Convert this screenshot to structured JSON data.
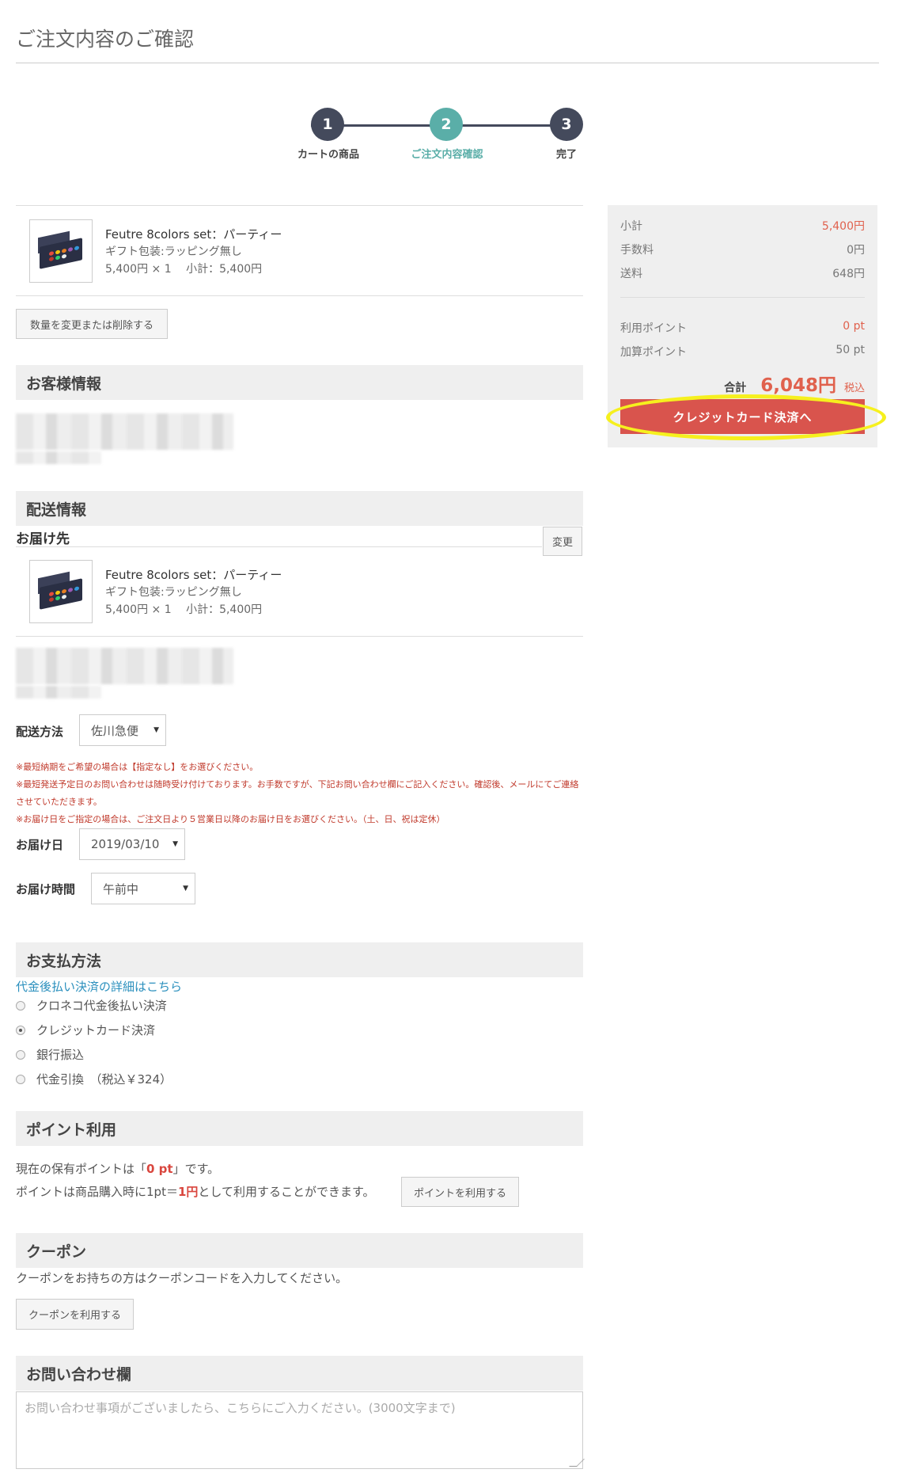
{
  "page": {
    "title": "ご注文内容のご確認"
  },
  "steps": [
    {
      "number": "1",
      "label": "カートの商品"
    },
    {
      "number": "2",
      "label": "ご注文内容確認"
    },
    {
      "number": "3",
      "label": "完了"
    }
  ],
  "cart_item": {
    "name": "Feutre 8colors set：パーティー",
    "gift": "ギフト包装:ラッピング無し",
    "price": "5,400円 × 1　 小計：5,400円",
    "change_button": "数量を変更または削除する"
  },
  "customer": {
    "header": "お客様情報"
  },
  "shipping": {
    "header": "配送情報",
    "destination_label": "お届け先",
    "change_button": "変更",
    "item_name": "Feutre 8colors set：パーティー",
    "item_gift": "ギフト包装:ラッピング無し",
    "item_price": "5,400円 × 1　 小計：5,400円",
    "method_label": "配送方法",
    "method_value": "佐川急便",
    "notes": [
      "※最短納期をご希望の場合は【指定なし】をお選びください。",
      "※最短発送予定日のお問い合わせは随時受け付けております。お手数ですが、下記お問い合わせ欄にご記入ください。確認後、メールにてご連絡させていただきます。",
      "※お届け日をご指定の場合は、ご注文日より５営業日以降のお届け日をお選びください。（土、日、祝は定休）"
    ],
    "date_label": "お届け日",
    "date_value": "2019/03/10",
    "time_label": "お届け時間",
    "time_value": "午前中"
  },
  "payment": {
    "header": "お支払方法",
    "link": "代金後払い決済の詳細はこちら",
    "options": [
      {
        "label": "クロネコ代金後払い決済",
        "checked": false
      },
      {
        "label": "クレジットカード決済",
        "checked": true
      },
      {
        "label": "銀行振込",
        "checked": false
      },
      {
        "label": "代金引換　（税込￥324）",
        "checked": false
      }
    ]
  },
  "points": {
    "header": "ポイント利用",
    "line1_pre": "現在の保有ポイントは「",
    "line1_value": "0 pt",
    "line1_post": "」です。",
    "line2_pre": "ポイントは商品購入時に1pt＝",
    "line2_value": "1円",
    "line2_post": "として利用することができます。",
    "button": "ポイントを利用する"
  },
  "coupon": {
    "header": "クーポン",
    "text": "クーポンをお持ちの方はクーポンコードを入力してください。",
    "button": "クーポンを利用する"
  },
  "inquiry": {
    "header": "お問い合わせ欄",
    "placeholder": "お問い合わせ事項がございましたら、こちらにご入力ください。(3000文字まで)"
  },
  "summary": {
    "subtotal_label": "小計",
    "subtotal_value": "5,400円",
    "fee_label": "手数料",
    "fee_value": "0円",
    "shipping_label": "送料",
    "shipping_value": "648円",
    "used_points_label": "利用ポイント",
    "used_points_value": "0 pt",
    "earned_points_label": "加算ポイント",
    "earned_points_value": "50 pt",
    "total_label": "合計",
    "total_value": "6,048円",
    "tax_label": "税込",
    "cta": "クレジットカード決済へ"
  },
  "colors": {
    "step_dark": "#444a5c",
    "step_active": "#5aaea8",
    "accent_red": "#d9544d",
    "highlight": "#f6f01e"
  }
}
